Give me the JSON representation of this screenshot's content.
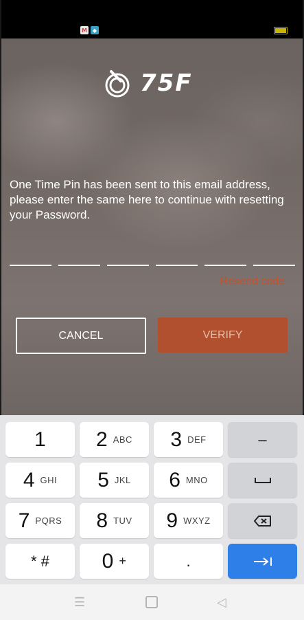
{
  "logo": {
    "text": "75F"
  },
  "message": "One Time Pin has been sent to this email address, please enter the same here to continue with resetting your Password.",
  "pin_boxes": [
    "",
    "",
    "",
    "",
    "",
    ""
  ],
  "resend_label": "Resend code",
  "cancel_label": "CANCEL",
  "verify_label": "VERIFY",
  "keyboard": {
    "k1": {
      "num": "1",
      "sub": ""
    },
    "k2": {
      "num": "2",
      "sub": "ABC"
    },
    "k3": {
      "num": "3",
      "sub": "DEF"
    },
    "k4": {
      "num": "4",
      "sub": "GHI"
    },
    "k5": {
      "num": "5",
      "sub": "JKL"
    },
    "k6": {
      "num": "6",
      "sub": "MNO"
    },
    "k7": {
      "num": "7",
      "sub": "PQRS"
    },
    "k8": {
      "num": "8",
      "sub": "TUV"
    },
    "k9": {
      "num": "9",
      "sub": "WXYZ"
    },
    "k0": {
      "num": "0",
      "sub": "+"
    },
    "star_hash": "* #",
    "dot": ".",
    "minus": "–",
    "space_icon": "space-bar-icon",
    "backspace_icon": "backspace-icon",
    "enter_icon": "tab-next-icon"
  },
  "status_icons": [
    "gmail-icon",
    "app-icon",
    "battery-icon"
  ],
  "nav_icons": [
    "menu-icon",
    "home-icon",
    "back-icon"
  ],
  "colors": {
    "accent": "#b0502f",
    "resend": "#c8502a",
    "keyboard_action": "#2f7fe8"
  }
}
